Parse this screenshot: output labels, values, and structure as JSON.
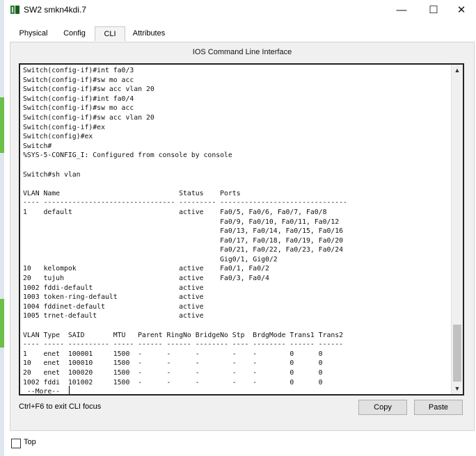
{
  "window": {
    "title": "SW2  smkn4kdi.7",
    "minimize_glyph": "—",
    "maximize_glyph": "☐",
    "close_glyph": "✕"
  },
  "tabs": [
    {
      "label": "Physical",
      "active": false
    },
    {
      "label": "Config",
      "active": false
    },
    {
      "label": "CLI",
      "active": true
    },
    {
      "label": "Attributes",
      "active": false
    }
  ],
  "cli": {
    "title": "IOS Command Line Interface",
    "output": "Switch(config-if)#int fa0/3\nSwitch(config-if)#sw mo acc\nSwitch(config-if)#sw acc vlan 20\nSwitch(config-if)#int fa0/4\nSwitch(config-if)#sw mo acc\nSwitch(config-if)#sw acc vlan 20\nSwitch(config-if)#ex\nSwitch(config)#ex\nSwitch#\n%SYS-5-CONFIG_I: Configured from console by console\n\nSwitch#sh vlan\n\nVLAN Name                             Status    Ports\n---- -------------------------------- --------- -------------------------------\n1    default                          active    Fa0/5, Fa0/6, Fa0/7, Fa0/8\n                                                Fa0/9, Fa0/10, Fa0/11, Fa0/12\n                                                Fa0/13, Fa0/14, Fa0/15, Fa0/16\n                                                Fa0/17, Fa0/18, Fa0/19, Fa0/20\n                                                Fa0/21, Fa0/22, Fa0/23, Fa0/24\n                                                Gig0/1, Gig0/2\n10   kelompok                         active    Fa0/1, Fa0/2\n20   tujuh                            active    Fa0/3, Fa0/4\n1002 fddi-default                     active\n1003 token-ring-default               active\n1004 fddinet-default                  active\n1005 trnet-default                    active\n\nVLAN Type  SAID       MTU   Parent RingNo BridgeNo Stp  BrdgMode Trans1 Trans2\n---- ----- ---------- ----- ------ ------ -------- ---- -------- ------ ------\n1    enet  100001     1500  -      -      -        -    -        0      0\n10   enet  100010     1500  -      -      -        -    -        0      0\n20   enet  100020     1500  -      -      -        -    -        0      0\n1002 fddi  101002     1500  -      -      -        -    -        0      0\n --More--",
    "scroll_up_glyph": "▲",
    "scroll_down_glyph": "▼"
  },
  "footer": {
    "hint": "Ctrl+F6 to exit CLI focus",
    "copy_label": "Copy",
    "paste_label": "Paste"
  },
  "bottom": {
    "top_label": "Top",
    "top_checked": false
  },
  "icons": {
    "app": "packet-tracer-switch-icon"
  },
  "colors": {
    "tab_underline": "#1f5fa8",
    "terminal_border": "#222222",
    "desktop_green": "#6cc04a"
  }
}
